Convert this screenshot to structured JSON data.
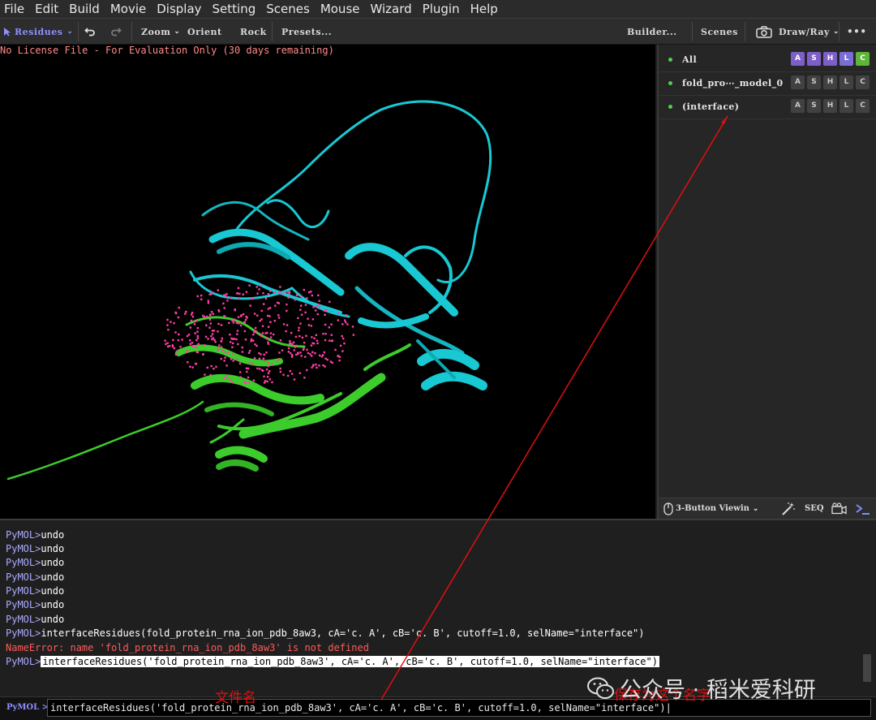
{
  "menu": [
    "File",
    "Edit",
    "Build",
    "Movie",
    "Display",
    "Setting",
    "Scenes",
    "Mouse",
    "Wizard",
    "Plugin",
    "Help"
  ],
  "toolbar": {
    "mode_label": "Residues",
    "zoom_label": "Zoom",
    "orient_label": "Orient",
    "rock_label": "Rock",
    "presets_label": "Presets...",
    "builder_label": "Builder...",
    "scenes_label": "Scenes",
    "draw_ray_label": "Draw/Ray",
    "more_label": "•••"
  },
  "viewport": {
    "license_text": "No License File - For Evaluation Only (30 days remaining)",
    "colors": {
      "chain_a": "#18c8d2",
      "chain_b": "#3ccc2c",
      "interface_dots": "#ff3fa5",
      "background": "#000000"
    }
  },
  "objects": [
    {
      "name": "All",
      "buttons": [
        "A",
        "S",
        "H",
        "L",
        "C"
      ]
    },
    {
      "name": "fold_pro⋯_model_0",
      "buttons": [
        "A",
        "S",
        "H",
        "L",
        "C"
      ]
    },
    {
      "name": "(interface)",
      "buttons": [
        "A",
        "S",
        "H",
        "L",
        "C"
      ]
    }
  ],
  "panel_bottom": {
    "mouse_mode_label": "3-Button Viewin",
    "seq_label": "SEQ"
  },
  "console": {
    "prompt": "PyMOL>",
    "lines": [
      {
        "prefix": "PyMOL>",
        "text": "undo"
      },
      {
        "prefix": "PyMOL>",
        "text": "undo"
      },
      {
        "prefix": "PyMOL>",
        "text": "undo"
      },
      {
        "prefix": "PyMOL>",
        "text": "undo"
      },
      {
        "prefix": "PyMOL>",
        "text": "undo"
      },
      {
        "prefix": "PyMOL>",
        "text": "undo"
      },
      {
        "prefix": "PyMOL>",
        "text": "undo"
      },
      {
        "prefix": "PyMOL>",
        "text": "interfaceResidues(fold_protein_rna_ion_pdb_8aw3, cA='c. A', cB='c. B', cutoff=1.0, selName=\"interface\")"
      }
    ],
    "error_line": "NameError: name 'fold_protein_rna_ion_pdb_8aw3' is not defined",
    "highlighted_command": "interfaceResidues('fold_protein_rna_ion_pdb_8aw3', cA='c. A', cB='c. B', cutoff=1.0, selName=\"interface\")"
  },
  "input": {
    "label": "PyMOL >",
    "value": "interfaceResidues('fold_protein_rna_ion_pdb_8aw3', cA='c. A', cB='c. B', cutoff=1.0, selName=\"interface\")|"
  },
  "annotations": {
    "filename_label": "文件名",
    "name_label": "保存为这个名字",
    "color": "#e01010"
  },
  "watermark": {
    "text": "公众号 · 稻米爱科研"
  }
}
